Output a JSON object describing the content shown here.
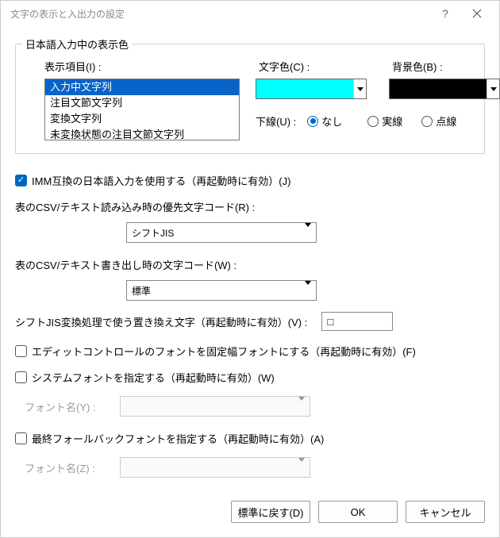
{
  "window": {
    "title": "文字の表示と入出力の設定"
  },
  "group": {
    "legend": "日本語入力中の表示色",
    "display_item_label": "表示項目(I) :",
    "items": [
      "入力中文字列",
      "注目文節文字列",
      "変換文字列",
      "未変換状態の注目文節文字列"
    ],
    "text_color_label": "文字色(C) :",
    "bg_color_label": "背景色(B) :",
    "text_color": "#00ffff",
    "bg_color": "#000000",
    "underline_label": "下線(U) :",
    "underline_options": {
      "none": "なし",
      "solid": "実線",
      "dotted": "点線"
    },
    "underline_selected": "none"
  },
  "opts": {
    "imm_label": "IMM互換の日本語入力を使用する（再起動時に有効）(J)",
    "imm_checked": true,
    "csv_read_label": "表のCSV/テキスト読み込み時の優先文字コード(R) :",
    "csv_read_value": "シフトJIS",
    "csv_write_label": "表のCSV/テキスト書き出し時の文字コード(W) :",
    "csv_write_value": "標準",
    "sjis_replace_label": "シフトJIS変換処理で使う置き換え文字（再起動時に有効）(V) :",
    "sjis_replace_value": "□",
    "fixed_font_label": "エディットコントロールのフォントを固定幅フォントにする（再起動時に有効）(F)",
    "fixed_font_checked": false,
    "sysfont_label": "システムフォントを指定する（再起動時に有効）(W)",
    "sysfont_checked": false,
    "sysfont_name_label": "フォント名(Y) :",
    "fallback_label": "最終フォールバックフォントを指定する（再起動時に有効）(A)",
    "fallback_checked": false,
    "fallback_name_label": "フォント名(Z) :"
  },
  "footer": {
    "reset": "標準に戻す(D)",
    "ok": "OK",
    "cancel": "キャンセル"
  }
}
